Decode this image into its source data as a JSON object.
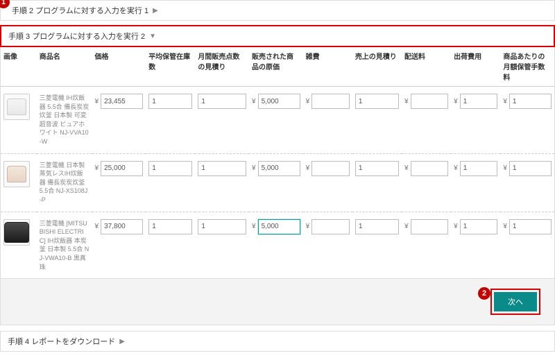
{
  "steps": {
    "s2_label": "手順 2 プログラムに対する入力を実行 1",
    "s3_label": "手順 3 プログラムに対する入力を実行 2",
    "s4_label": "手順 4 レポートをダウンロード"
  },
  "headers": {
    "image": "画像",
    "name": "商品名",
    "price": "価格",
    "avg_stock": "平均保管在庫数",
    "monthly_sales": "月間販売点数の見積り",
    "sold_cost": "販売された商品の原価",
    "misc": "雑費",
    "revenue": "売上の見積り",
    "shipping": "配送料",
    "outbound": "出荷費用",
    "monthly_fee": "商品あたりの月額保管手数料"
  },
  "rows": [
    {
      "thumb_class": "cooker-white",
      "name": "三菱電機 IH炊飯器 5.5合 備長炭炭炊釜 日本製 可変超音波 ピュアホワイト NJ-VVA10-W",
      "price": "23,455",
      "avg_stock": "1",
      "monthly_sales": "1",
      "sold_cost": "5,000",
      "misc": "",
      "revenue": "1",
      "shipping": "",
      "outbound": "1",
      "monthly_fee": "1",
      "focus": false
    },
    {
      "thumb_class": "cooker-pink",
      "name": "三菱電機 日本製 蒸気レスIH炊飯器 備長炭炭炊釜 5.5合 NJ-XS108J-P",
      "price": "25,000",
      "avg_stock": "1",
      "monthly_sales": "1",
      "sold_cost": "5,000",
      "misc": "",
      "revenue": "1",
      "shipping": "",
      "outbound": "1",
      "monthly_fee": "1",
      "focus": false
    },
    {
      "thumb_class": "cooker-black",
      "name": "三菱電機 [MITSUBISHI ELECTRIC] IH炊飯器 本炭釜 日本製 5.5合 NJ-VWA10-B 黒真珠",
      "price": "37,800",
      "avg_stock": "1",
      "monthly_sales": "1",
      "sold_cost": "5,000",
      "misc": "",
      "revenue": "1",
      "shipping": "",
      "outbound": "1",
      "monthly_fee": "1",
      "focus": true
    }
  ],
  "buttons": {
    "next": "次へ"
  },
  "callouts": {
    "one": "1",
    "two": "2"
  },
  "yen": "¥"
}
